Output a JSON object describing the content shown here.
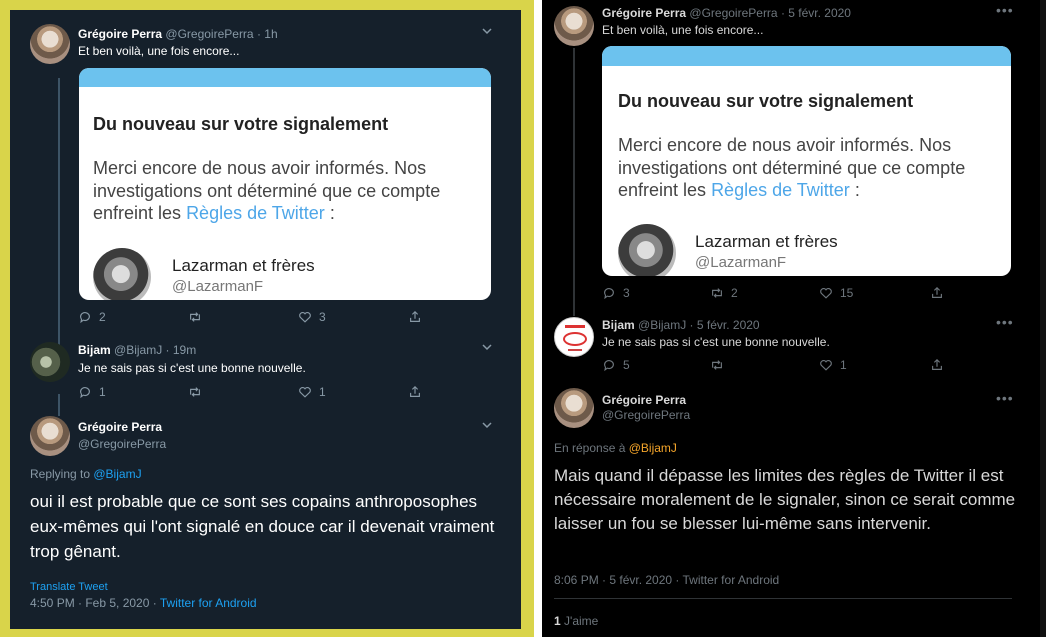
{
  "left": {
    "border_color": "#d9d44a",
    "bg": "#15202b",
    "tweet1": {
      "name": "Grégoire Perra",
      "handle": "@GregoirePerra · 1h",
      "text": "Et ben voilà, une fois encore...",
      "card": {
        "title": "Du nouveau sur votre signalement",
        "body_a": "Merci encore de nous avoir informés. Nos investigations ont déterminé que ce compte enfreint les ",
        "body_link": "Règles de Twitter",
        "body_b": " :",
        "user_name": "Lazarman et frères",
        "user_handle": "@LazarmanF"
      },
      "replies": "2",
      "retweets": "",
      "likes": "3"
    },
    "tweet2": {
      "name": "Bijam",
      "handle": "@BijamJ · 19m",
      "text": "Je ne sais pas si c'est une bonne nouvelle.",
      "replies": "1",
      "retweets": "",
      "likes": "1"
    },
    "tweet3": {
      "name": "Grégoire Perra",
      "handle": "@GregoirePerra",
      "replying_prefix": "Replying to ",
      "replying_to": "@BijamJ",
      "text": "oui il est probable que ce sont ses copains anthroposophes eux-mêmes qui l'ont signalé en douce car il devenait vraiment trop gênant.",
      "translate": "Translate Tweet",
      "meta": "4:50 PM · Feb 5, 2020 · ",
      "source": "Twitter for Android"
    }
  },
  "right": {
    "bg": "#000000",
    "tweet1": {
      "name": "Grégoire Perra",
      "handle": "@GregoirePerra · 5 févr. 2020",
      "text": "Et ben voilà, une fois encore...",
      "card": {
        "title": "Du nouveau sur votre signalement",
        "body_a": "Merci encore de nous avoir informés. Nos investigations ont déterminé que ce compte enfreint les ",
        "body_link": "Règles de Twitter",
        "body_b": " :",
        "user_name": "Lazarman et frères",
        "user_handle": "@LazarmanF"
      },
      "replies": "3",
      "retweets": "2",
      "likes": "15"
    },
    "tweet2": {
      "name": "Bijam",
      "handle": "@BijamJ · 5 févr. 2020",
      "text": "Je ne sais pas si c'est une bonne nouvelle.",
      "replies": "5",
      "retweets": "",
      "likes": "1"
    },
    "tweet3": {
      "name": "Grégoire Perra",
      "handle": "@GregoirePerra",
      "replying_prefix": "En réponse à ",
      "replying_to": "@BijamJ",
      "text": "Mais quand il dépasse les limites des règles de Twitter il est nécessaire moralement de le signaler, sinon ce serait comme laisser un fou se blesser lui-même sans intervenir.",
      "meta": "8:06 PM · 5 févr. 2020 · Twitter for Android",
      "likes_count": "1",
      "likes_label": " J'aime"
    }
  }
}
